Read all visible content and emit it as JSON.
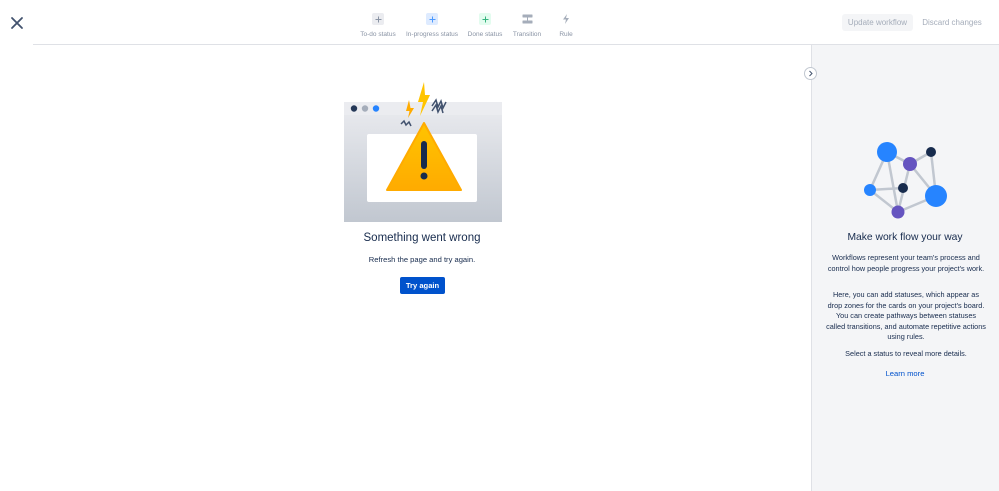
{
  "header": {
    "close_icon": "close-icon",
    "toolbar": [
      {
        "label": "To-do status",
        "icon": "plus-icon",
        "color": "#8993a4"
      },
      {
        "label": "In-progress status",
        "icon": "plus-icon",
        "color": "#4c9aff"
      },
      {
        "label": "Done status",
        "icon": "plus-icon",
        "color": "#36b37e"
      },
      {
        "label": "Transition",
        "icon": "transition-icon",
        "color": "#8993a4"
      },
      {
        "label": "Rule",
        "icon": "lightning-icon",
        "color": "#8993a4"
      }
    ],
    "update_label": "Update workflow",
    "discard_label": "Discard changes"
  },
  "main": {
    "error_title": "Something went wrong",
    "error_message": "Refresh the page and try again.",
    "try_again_label": "Try again"
  },
  "panel": {
    "title": "Make work flow your way",
    "paragraph1": "Workflows represent your team's process and control how people progress your project's work.",
    "paragraph2": "Here, you can add statuses, which appear as drop zones for the cards on your project's board. You can create pathways between statuses called transitions, and automate repetitive actions using rules.",
    "paragraph3": "Select a status to reveal more details.",
    "learn_more": "Learn more"
  },
  "colors": {
    "primary": "#0052cc",
    "warning": "#ffab00",
    "panel_bg": "#f4f5f7"
  }
}
